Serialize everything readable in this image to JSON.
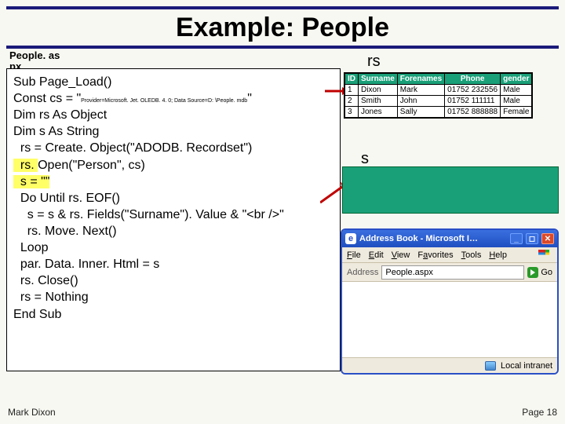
{
  "title": "Example: People",
  "file_label_line1": "People. as",
  "file_label_line2": "px",
  "rs_label": "rs",
  "s_label": "s",
  "code": {
    "l1_pre": "Sub Page_Load()",
    "l2_pre": "Const cs = \"",
    "l2_sm": "Provider=Microsoft. Jet. OLEDB. 4. 0; Data Source=D: \\People. mdb",
    "l2_post": "\"",
    "l3": "Dim rs As Object",
    "l4": "Dim s As String",
    "l5": "  rs = Create. Object(\"ADODB. Recordset\")",
    "l6_hl": "  rs. ",
    "l6_rest": "Open(\"Person\", cs)",
    "l7_hl": "  s = \"\"",
    "l8": "  Do Until rs. EOF()",
    "l9": "    s = s & rs. Fields(\"Surname\"). Value & \"<br />\"",
    "l10": "    rs. Move. Next()",
    "l11": "  Loop",
    "l12": "  par. Data. Inner. Html = s",
    "l13": "  rs. Close()",
    "l14": "  rs = Nothing",
    "l15": "End Sub"
  },
  "table": {
    "headers": [
      "ID",
      "Surname",
      "Forenames",
      "Phone",
      "gender"
    ],
    "rows": [
      [
        "1",
        "Dixon",
        "Mark",
        "01752 232556",
        "Male"
      ],
      [
        "2",
        "Smith",
        "John",
        "01752 111111",
        "Male"
      ],
      [
        "3",
        "Jones",
        "Sally",
        "01752 888888",
        "Female"
      ]
    ]
  },
  "ie": {
    "title": "Address Book - Microsoft I…",
    "menu": [
      "File",
      "Edit",
      "View",
      "Favorites",
      "Tools",
      "Help"
    ],
    "addr_label": "Address",
    "addr_value": "People.aspx",
    "go_label": "Go",
    "status": "Local intranet"
  },
  "footer": {
    "left": "Mark Dixon",
    "right": "Page 18"
  }
}
